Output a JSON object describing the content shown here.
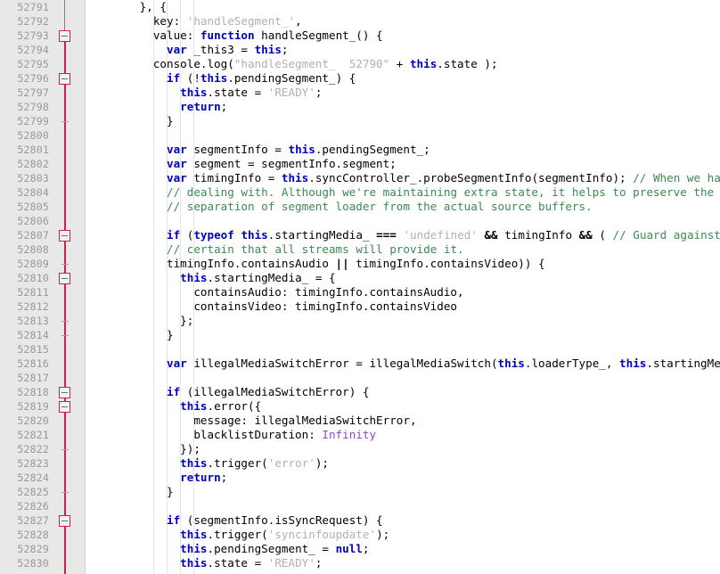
{
  "editor": {
    "first_line": 52791,
    "last_line": 52830,
    "line_height": 16,
    "gutter_width": 96,
    "colors": {
      "gutter_bg": "#e8e8e8",
      "line_number": "#999999",
      "fold_line": "#cc2244",
      "keyword": "#0000c0",
      "string": "#b0b0b0",
      "comment": "#3a8a52",
      "constant": "#8a49c8",
      "background": "#ffffff",
      "indent_guide": "#e4e4e4"
    }
  },
  "line_numbers": [
    "52791",
    "52792",
    "52793",
    "52794",
    "52795",
    "52796",
    "52797",
    "52798",
    "52799",
    "52800",
    "52801",
    "52802",
    "52803",
    "52804",
    "52805",
    "52806",
    "52807",
    "52808",
    "52809",
    "52810",
    "52811",
    "52812",
    "52813",
    "52814",
    "52815",
    "52816",
    "52817",
    "52818",
    "52819",
    "52820",
    "52821",
    "52822",
    "52823",
    "52824",
    "52825",
    "52826",
    "52827",
    "52828",
    "52829",
    "52830"
  ],
  "fold_markers": [
    {
      "line": 52793,
      "type": "box"
    },
    {
      "line": 52796,
      "type": "box"
    },
    {
      "line": 52799,
      "type": "tick"
    },
    {
      "line": 52807,
      "type": "box"
    },
    {
      "line": 52809,
      "type": "tick"
    },
    {
      "line": 52810,
      "type": "box"
    },
    {
      "line": 52813,
      "type": "tick"
    },
    {
      "line": 52814,
      "type": "tick"
    },
    {
      "line": 52818,
      "type": "box"
    },
    {
      "line": 52819,
      "type": "box"
    },
    {
      "line": 52822,
      "type": "tick"
    },
    {
      "line": 52825,
      "type": "tick"
    },
    {
      "line": 52827,
      "type": "box"
    }
  ],
  "code_lines": [
    {
      "n": "52791",
      "tokens": [
        {
          "t": "        }, {",
          "c": "pl"
        }
      ]
    },
    {
      "n": "52792",
      "tokens": [
        {
          "t": "          key: ",
          "c": "pl"
        },
        {
          "t": "'handleSegment_'",
          "c": "str"
        },
        {
          "t": ",",
          "c": "pl"
        }
      ]
    },
    {
      "n": "52793",
      "tokens": [
        {
          "t": "          value: ",
          "c": "pl"
        },
        {
          "t": "function",
          "c": "kw"
        },
        {
          "t": " handleSegment_() {",
          "c": "pl"
        }
      ]
    },
    {
      "n": "52794",
      "tokens": [
        {
          "t": "            ",
          "c": "pl"
        },
        {
          "t": "var",
          "c": "kw"
        },
        {
          "t": " _this3 = ",
          "c": "pl"
        },
        {
          "t": "this",
          "c": "kw"
        },
        {
          "t": ";",
          "c": "pl"
        }
      ]
    },
    {
      "n": "52795",
      "tokens": [
        {
          "t": "          console.log(",
          "c": "pl"
        },
        {
          "t": "\"handleSegment_  52790\"",
          "c": "str"
        },
        {
          "t": " + ",
          "c": "pl"
        },
        {
          "t": "this",
          "c": "kw"
        },
        {
          "t": ".state );",
          "c": "pl"
        }
      ]
    },
    {
      "n": "52796",
      "tokens": [
        {
          "t": "            ",
          "c": "pl"
        },
        {
          "t": "if",
          "c": "kw"
        },
        {
          "t": " (!",
          "c": "pl"
        },
        {
          "t": "this",
          "c": "kw"
        },
        {
          "t": ".pendingSegment_) {",
          "c": "pl"
        }
      ]
    },
    {
      "n": "52797",
      "tokens": [
        {
          "t": "              ",
          "c": "pl"
        },
        {
          "t": "this",
          "c": "kw"
        },
        {
          "t": ".state = ",
          "c": "pl"
        },
        {
          "t": "'READY'",
          "c": "str"
        },
        {
          "t": ";",
          "c": "pl"
        }
      ]
    },
    {
      "n": "52798",
      "tokens": [
        {
          "t": "              ",
          "c": "pl"
        },
        {
          "t": "return",
          "c": "kw"
        },
        {
          "t": ";",
          "c": "pl"
        }
      ]
    },
    {
      "n": "52799",
      "tokens": [
        {
          "t": "            }",
          "c": "pl"
        }
      ]
    },
    {
      "n": "52800",
      "tokens": [
        {
          "t": "",
          "c": "pl"
        }
      ]
    },
    {
      "n": "52801",
      "tokens": [
        {
          "t": "            ",
          "c": "pl"
        },
        {
          "t": "var",
          "c": "kw"
        },
        {
          "t": " segmentInfo = ",
          "c": "pl"
        },
        {
          "t": "this",
          "c": "kw"
        },
        {
          "t": ".pendingSegment_;",
          "c": "pl"
        }
      ]
    },
    {
      "n": "52802",
      "tokens": [
        {
          "t": "            ",
          "c": "pl"
        },
        {
          "t": "var",
          "c": "kw"
        },
        {
          "t": " segment = segmentInfo.segment;",
          "c": "pl"
        }
      ]
    },
    {
      "n": "52803",
      "tokens": [
        {
          "t": "            ",
          "c": "pl"
        },
        {
          "t": "var",
          "c": "kw"
        },
        {
          "t": " timingInfo = ",
          "c": "pl"
        },
        {
          "t": "this",
          "c": "kw"
        },
        {
          "t": ".syncController_.probeSegmentInfo(segmentInfo); ",
          "c": "pl"
        },
        {
          "t": "// When we have",
          "c": "cmt"
        }
      ]
    },
    {
      "n": "52804",
      "tokens": [
        {
          "t": "            ",
          "c": "pl"
        },
        {
          "t": "// dealing with. Although we're maintaining extra state, it helps to preserve the",
          "c": "cmt"
        }
      ]
    },
    {
      "n": "52805",
      "tokens": [
        {
          "t": "            ",
          "c": "pl"
        },
        {
          "t": "// separation of segment loader from the actual source buffers.",
          "c": "cmt"
        }
      ]
    },
    {
      "n": "52806",
      "tokens": [
        {
          "t": "",
          "c": "pl"
        }
      ]
    },
    {
      "n": "52807",
      "tokens": [
        {
          "t": "            ",
          "c": "pl"
        },
        {
          "t": "if",
          "c": "kw"
        },
        {
          "t": " (",
          "c": "pl"
        },
        {
          "t": "typeof",
          "c": "kw"
        },
        {
          "t": " ",
          "c": "pl"
        },
        {
          "t": "this",
          "c": "kw"
        },
        {
          "t": ".startingMedia_ ",
          "c": "pl"
        },
        {
          "t": "===",
          "c": "opb"
        },
        {
          "t": " ",
          "c": "pl"
        },
        {
          "t": "'undefined'",
          "c": "str"
        },
        {
          "t": " ",
          "c": "pl"
        },
        {
          "t": "&&",
          "c": "opb"
        },
        {
          "t": " timingInfo ",
          "c": "pl"
        },
        {
          "t": "&&",
          "c": "opb"
        },
        {
          "t": " ( ",
          "c": "pl"
        },
        {
          "t": "// Guard against",
          "c": "cmt"
        }
      ]
    },
    {
      "n": "52808",
      "tokens": [
        {
          "t": "            ",
          "c": "pl"
        },
        {
          "t": "// certain that all streams will provide it.",
          "c": "cmt"
        }
      ]
    },
    {
      "n": "52809",
      "tokens": [
        {
          "t": "            timingInfo.containsAudio ",
          "c": "pl"
        },
        {
          "t": "||",
          "c": "opb"
        },
        {
          "t": " timingInfo.containsVideo)) {",
          "c": "pl"
        }
      ]
    },
    {
      "n": "52810",
      "tokens": [
        {
          "t": "              ",
          "c": "pl"
        },
        {
          "t": "this",
          "c": "kw"
        },
        {
          "t": ".startingMedia_ = {",
          "c": "pl"
        }
      ]
    },
    {
      "n": "52811",
      "tokens": [
        {
          "t": "                containsAudio: timingInfo.containsAudio,",
          "c": "pl"
        }
      ]
    },
    {
      "n": "52812",
      "tokens": [
        {
          "t": "                containsVideo: timingInfo.containsVideo",
          "c": "pl"
        }
      ]
    },
    {
      "n": "52813",
      "tokens": [
        {
          "t": "              };",
          "c": "pl"
        }
      ]
    },
    {
      "n": "52814",
      "tokens": [
        {
          "t": "            }",
          "c": "pl"
        }
      ]
    },
    {
      "n": "52815",
      "tokens": [
        {
          "t": "",
          "c": "pl"
        }
      ]
    },
    {
      "n": "52816",
      "tokens": [
        {
          "t": "            ",
          "c": "pl"
        },
        {
          "t": "var",
          "c": "kw"
        },
        {
          "t": " illegalMediaSwitchError = illegalMediaSwitch(",
          "c": "pl"
        },
        {
          "t": "this",
          "c": "kw"
        },
        {
          "t": ".loaderType_, ",
          "c": "pl"
        },
        {
          "t": "this",
          "c": "kw"
        },
        {
          "t": ".startingMed",
          "c": "pl"
        }
      ]
    },
    {
      "n": "52817",
      "tokens": [
        {
          "t": "",
          "c": "pl"
        }
      ]
    },
    {
      "n": "52818",
      "tokens": [
        {
          "t": "            ",
          "c": "pl"
        },
        {
          "t": "if",
          "c": "kw"
        },
        {
          "t": " (illegalMediaSwitchError) {",
          "c": "pl"
        }
      ]
    },
    {
      "n": "52819",
      "tokens": [
        {
          "t": "              ",
          "c": "pl"
        },
        {
          "t": "this",
          "c": "kw"
        },
        {
          "t": ".error({",
          "c": "pl"
        }
      ]
    },
    {
      "n": "52820",
      "tokens": [
        {
          "t": "                message: illegalMediaSwitchError,",
          "c": "pl"
        }
      ]
    },
    {
      "n": "52821",
      "tokens": [
        {
          "t": "                blacklistDuration: ",
          "c": "pl"
        },
        {
          "t": "Infinity",
          "c": "num"
        }
      ]
    },
    {
      "n": "52822",
      "tokens": [
        {
          "t": "              });",
          "c": "pl"
        }
      ]
    },
    {
      "n": "52823",
      "tokens": [
        {
          "t": "              ",
          "c": "pl"
        },
        {
          "t": "this",
          "c": "kw"
        },
        {
          "t": ".trigger(",
          "c": "pl"
        },
        {
          "t": "'error'",
          "c": "str"
        },
        {
          "t": ");",
          "c": "pl"
        }
      ]
    },
    {
      "n": "52824",
      "tokens": [
        {
          "t": "              ",
          "c": "pl"
        },
        {
          "t": "return",
          "c": "kw"
        },
        {
          "t": ";",
          "c": "pl"
        }
      ]
    },
    {
      "n": "52825",
      "tokens": [
        {
          "t": "            }",
          "c": "pl"
        }
      ]
    },
    {
      "n": "52826",
      "tokens": [
        {
          "t": "",
          "c": "pl"
        }
      ]
    },
    {
      "n": "52827",
      "tokens": [
        {
          "t": "            ",
          "c": "pl"
        },
        {
          "t": "if",
          "c": "kw"
        },
        {
          "t": " (segmentInfo.isSyncRequest) {",
          "c": "pl"
        }
      ]
    },
    {
      "n": "52828",
      "tokens": [
        {
          "t": "              ",
          "c": "pl"
        },
        {
          "t": "this",
          "c": "kw"
        },
        {
          "t": ".trigger(",
          "c": "pl"
        },
        {
          "t": "'syncinfoupdate'",
          "c": "str"
        },
        {
          "t": ");",
          "c": "pl"
        }
      ]
    },
    {
      "n": "52829",
      "tokens": [
        {
          "t": "              ",
          "c": "pl"
        },
        {
          "t": "this",
          "c": "kw"
        },
        {
          "t": ".pendingSegment_ = ",
          "c": "pl"
        },
        {
          "t": "null",
          "c": "kw"
        },
        {
          "t": ";",
          "c": "pl"
        }
      ]
    },
    {
      "n": "52830",
      "tokens": [
        {
          "t": "              ",
          "c": "pl"
        },
        {
          "t": "this",
          "c": "kw"
        },
        {
          "t": ".state = ",
          "c": "pl"
        },
        {
          "t": "'READY'",
          "c": "str"
        },
        {
          "t": ";",
          "c": "pl"
        }
      ]
    }
  ],
  "indent_guide_columns": [
    10,
    12,
    14,
    16
  ]
}
